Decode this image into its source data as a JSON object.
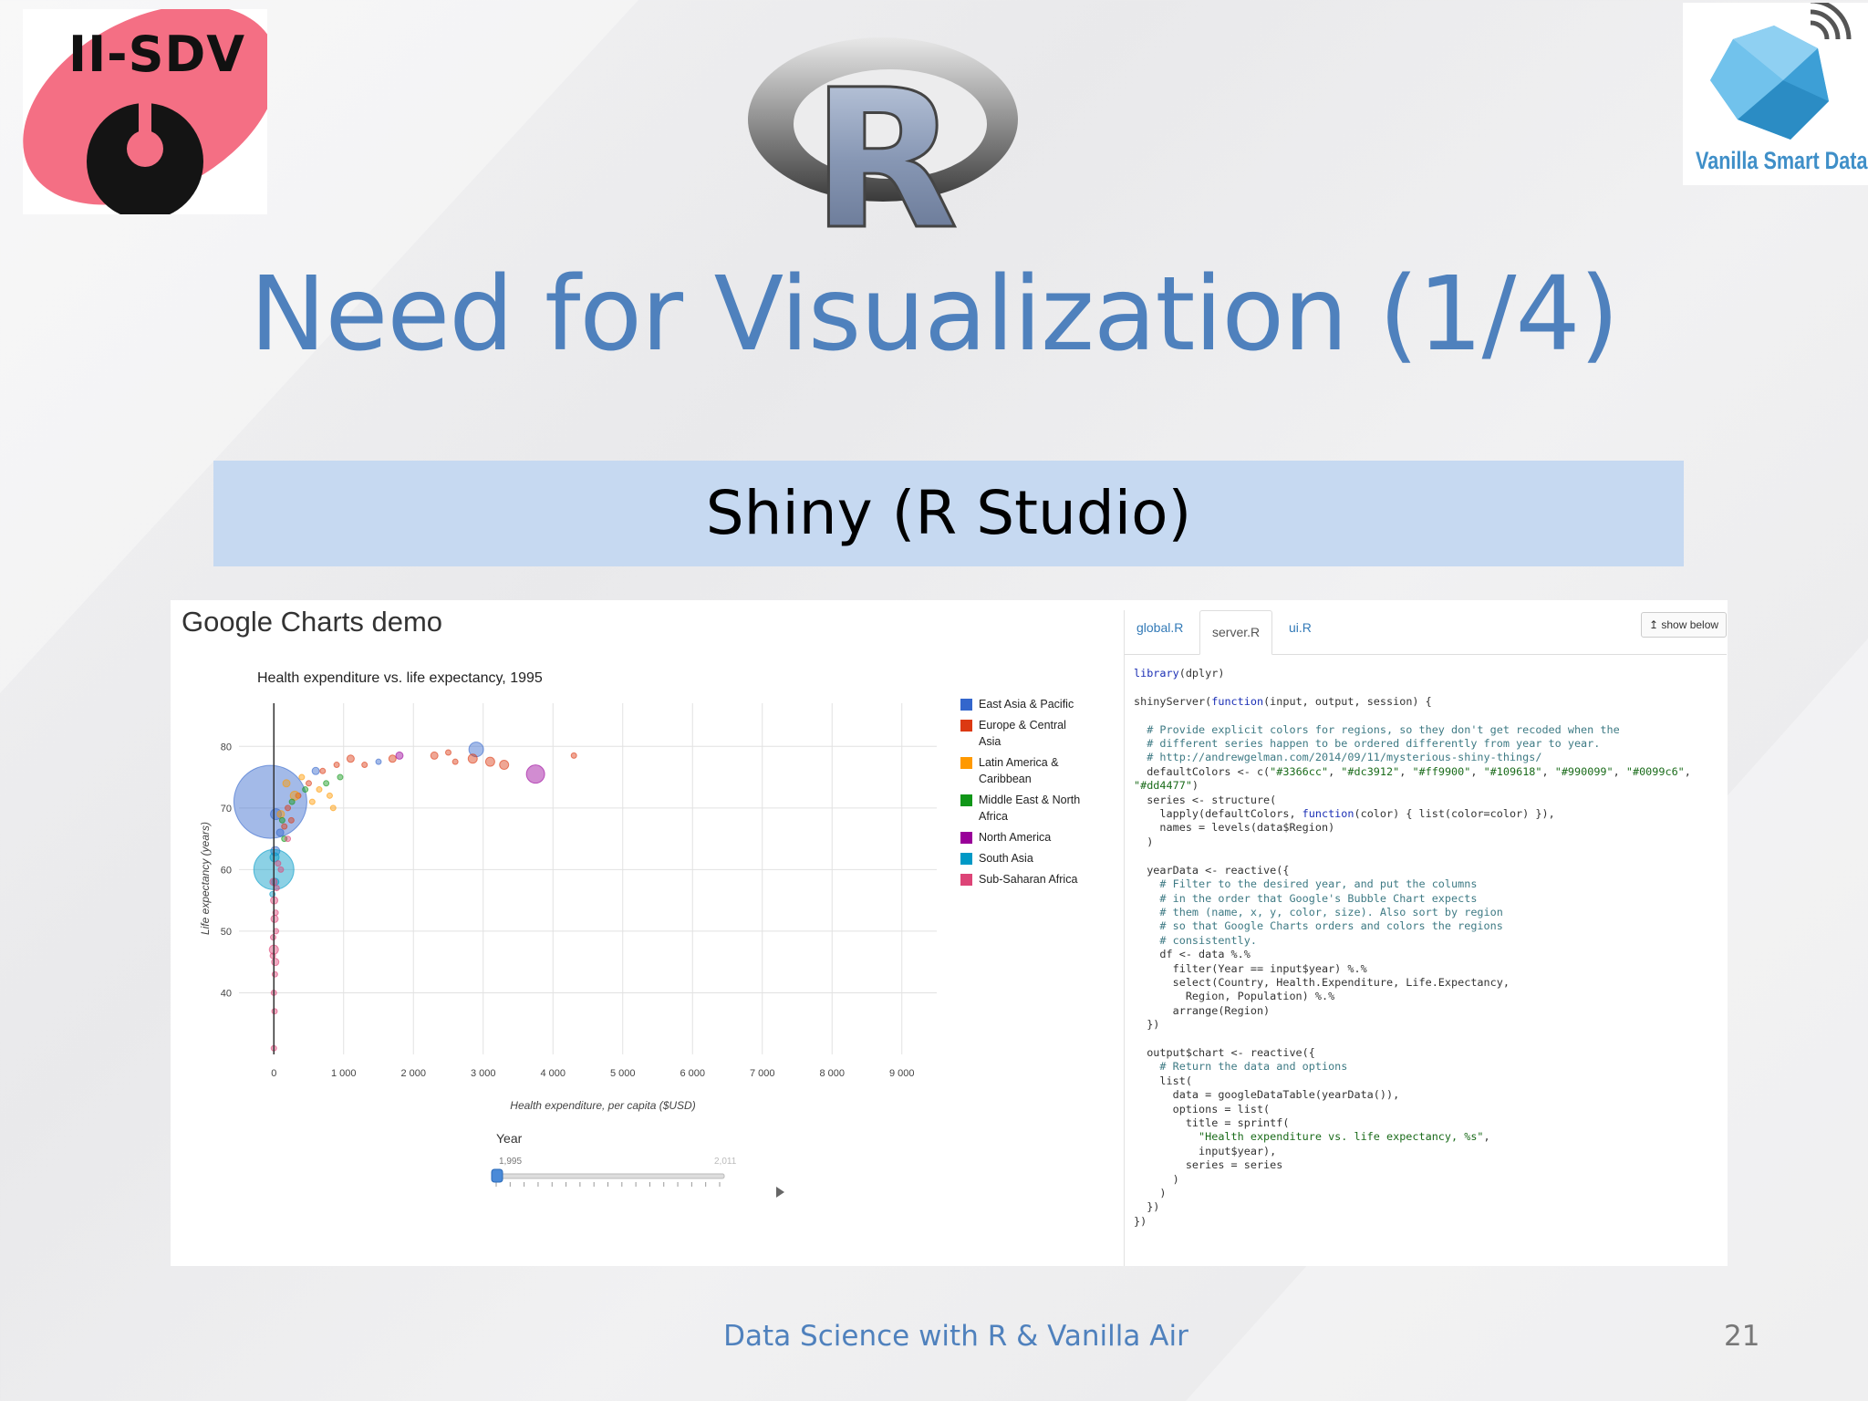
{
  "slide": {
    "title": "Need for Visualization (1/4)",
    "banner": "Shiny (R Studio)",
    "footer": "Data Science with R & Vanilla Air",
    "page_number": "21",
    "accent_color": "#4f81bd",
    "banner_color": "#c6d9f1"
  },
  "logos": {
    "left_text": "II-SDV",
    "center_letter": "R",
    "right_text": "Vanilla Smart Data"
  },
  "app": {
    "title": "Google Charts demo",
    "tabs": [
      {
        "label": "global.R",
        "active": false
      },
      {
        "label": "server.R",
        "active": true
      },
      {
        "label": "ui.R",
        "active": false
      }
    ],
    "show_below_label": "show below",
    "slider": {
      "label": "Year",
      "min_label": "1,995",
      "max_label": "2,011",
      "value": 1995,
      "min": 1995,
      "max": 2011
    }
  },
  "chart_data": {
    "type": "scatter",
    "title": "Health expenditure vs. life expectancy, 1995",
    "xlabel": "Health expenditure, per capita ($USD)",
    "ylabel": "Life expectancy (years)",
    "xlim": [
      -500,
      9500
    ],
    "ylim": [
      30,
      87
    ],
    "x_ticks": [
      0,
      1000,
      2000,
      3000,
      4000,
      5000,
      6000,
      7000,
      8000,
      9000
    ],
    "x_tick_labels": [
      "0",
      "1 000",
      "2 000",
      "3 000",
      "4 000",
      "5 000",
      "6 000",
      "7 000",
      "8 000",
      "9 000"
    ],
    "y_ticks": [
      40,
      50,
      60,
      70,
      80
    ],
    "grid": true,
    "legend_position": "right",
    "series": [
      {
        "name": "East Asia & Pacific",
        "color": "#3366cc",
        "points": [
          [
            -50,
            71,
            40
          ],
          [
            30,
            69,
            6
          ],
          [
            90,
            66,
            4
          ],
          [
            20,
            63,
            5
          ],
          [
            2900,
            79.5,
            8
          ],
          [
            600,
            76,
            4
          ],
          [
            1500,
            77.5,
            3
          ]
        ]
      },
      {
        "name": "Europe & Central Asia",
        "color": "#dc3912",
        "points": [
          [
            1100,
            78,
            4
          ],
          [
            1700,
            78,
            4
          ],
          [
            2300,
            78.5,
            4
          ],
          [
            2850,
            78,
            5
          ],
          [
            3100,
            77.5,
            5
          ],
          [
            3300,
            77,
            5
          ],
          [
            1300,
            77,
            3
          ],
          [
            2500,
            79,
            3
          ],
          [
            4300,
            78.5,
            3
          ],
          [
            200,
            70,
            3
          ],
          [
            350,
            72,
            3
          ],
          [
            500,
            74,
            3
          ],
          [
            150,
            67,
            3
          ],
          [
            250,
            68,
            3
          ],
          [
            700,
            76,
            3
          ],
          [
            900,
            77,
            3
          ],
          [
            2600,
            77.5,
            3
          ]
        ]
      },
      {
        "name": "Latin America & Caribbean",
        "color": "#ff9900",
        "points": [
          [
            300,
            72,
            5
          ],
          [
            100,
            69,
            4
          ],
          [
            180,
            74,
            4
          ],
          [
            400,
            75,
            3
          ],
          [
            800,
            72,
            3
          ],
          [
            550,
            71,
            3
          ],
          [
            650,
            73,
            3
          ],
          [
            850,
            70,
            3
          ]
        ]
      },
      {
        "name": "Middle East & North Africa",
        "color": "#109618",
        "points": [
          [
            120,
            68,
            3
          ],
          [
            260,
            71,
            3
          ],
          [
            450,
            73,
            3
          ],
          [
            750,
            74,
            3
          ],
          [
            950,
            75,
            3
          ],
          [
            150,
            65,
            3
          ]
        ]
      },
      {
        "name": "North America",
        "color": "#990099",
        "points": [
          [
            3750,
            75.5,
            10
          ],
          [
            1800,
            78.5,
            4
          ]
        ]
      },
      {
        "name": "South Asia",
        "color": "#0099c6",
        "points": [
          [
            0,
            60,
            22
          ],
          [
            10,
            62,
            5
          ],
          [
            20,
            58,
            4
          ],
          [
            -20,
            56,
            3
          ]
        ]
      },
      {
        "name": "Sub-Saharan Africa",
        "color": "#dd4477",
        "points": [
          [
            10,
            52,
            4
          ],
          [
            0,
            47,
            5
          ],
          [
            20,
            45,
            4
          ],
          [
            -10,
            49,
            3
          ],
          [
            5,
            55,
            4
          ],
          [
            15,
            43,
            3
          ],
          [
            0,
            40,
            3
          ],
          [
            25,
            53,
            3
          ],
          [
            -5,
            58,
            4
          ],
          [
            40,
            57,
            3
          ],
          [
            60,
            61,
            3
          ],
          [
            10,
            37,
            3
          ],
          [
            0,
            31,
            3
          ],
          [
            100,
            60,
            3
          ],
          [
            200,
            65,
            3
          ],
          [
            30,
            50,
            3
          ],
          [
            -15,
            46,
            3
          ]
        ]
      }
    ]
  },
  "code": [
    [
      [
        "k",
        "library"
      ],
      [
        "t",
        "(dplyr)"
      ]
    ],
    [],
    [
      [
        "t",
        "shinyServer("
      ],
      [
        "k",
        "function"
      ],
      [
        "t",
        "(input, output, session) {"
      ]
    ],
    [],
    [
      [
        "c",
        "  # Provide explicit colors for regions, so they don't get recoded when the"
      ]
    ],
    [
      [
        "c",
        "  # different series happen to be ordered differently from year to year."
      ]
    ],
    [
      [
        "c",
        "  # http://andrewgelman.com/2014/09/11/mysterious-shiny-things/"
      ]
    ],
    [
      [
        "t",
        "  defaultColors <- c("
      ],
      [
        "s",
        "\"#3366cc\""
      ],
      [
        "t",
        ", "
      ],
      [
        "s",
        "\"#dc3912\""
      ],
      [
        "t",
        ", "
      ],
      [
        "s",
        "\"#ff9900\""
      ],
      [
        "t",
        ", "
      ],
      [
        "s",
        "\"#109618\""
      ],
      [
        "t",
        ", "
      ],
      [
        "s",
        "\"#990099\""
      ],
      [
        "t",
        ", "
      ],
      [
        "s",
        "\"#0099c6\""
      ],
      [
        "t",
        ","
      ]
    ],
    [
      [
        "s",
        "\"#dd4477\""
      ],
      [
        "t",
        ")"
      ]
    ],
    [
      [
        "t",
        "  series <- structure("
      ]
    ],
    [
      [
        "t",
        "    lapply(defaultColors, "
      ],
      [
        "k",
        "function"
      ],
      [
        "t",
        "(color) { list(color=color) }),"
      ]
    ],
    [
      [
        "t",
        "    names = levels(data$Region)"
      ]
    ],
    [
      [
        "t",
        "  )"
      ]
    ],
    [],
    [
      [
        "t",
        "  yearData <- reactive({"
      ]
    ],
    [
      [
        "c",
        "    # Filter to the desired year, and put the columns"
      ]
    ],
    [
      [
        "c",
        "    # in the order that Google's Bubble Chart expects"
      ]
    ],
    [
      [
        "c",
        "    # them (name, x, y, color, size). Also sort by region"
      ]
    ],
    [
      [
        "c",
        "    # so that Google Charts orders and colors the regions"
      ]
    ],
    [
      [
        "c",
        "    # consistently."
      ]
    ],
    [
      [
        "t",
        "    df <- data %.%"
      ]
    ],
    [
      [
        "t",
        "      filter(Year == input$year) %.%"
      ]
    ],
    [
      [
        "t",
        "      select(Country, Health.Expenditure, Life.Expectancy,"
      ]
    ],
    [
      [
        "t",
        "        Region, Population) %.%"
      ]
    ],
    [
      [
        "t",
        "      arrange(Region)"
      ]
    ],
    [
      [
        "t",
        "  })"
      ]
    ],
    [],
    [
      [
        "t",
        "  output$chart <- reactive({"
      ]
    ],
    [
      [
        "c",
        "    # Return the data and options"
      ]
    ],
    [
      [
        "t",
        "    list("
      ]
    ],
    [
      [
        "t",
        "      data = googleDataTable(yearData()),"
      ]
    ],
    [
      [
        "t",
        "      options = list("
      ]
    ],
    [
      [
        "t",
        "        title = sprintf("
      ]
    ],
    [
      [
        "s",
        "          \"Health expenditure vs. life expectancy, %s\""
      ],
      [
        "t",
        ","
      ]
    ],
    [
      [
        "t",
        "          input$year),"
      ]
    ],
    [
      [
        "t",
        "        series = series"
      ]
    ],
    [
      [
        "t",
        "      )"
      ]
    ],
    [
      [
        "t",
        "    )"
      ]
    ],
    [
      [
        "t",
        "  })"
      ]
    ],
    [
      [
        "t",
        "})"
      ]
    ]
  ]
}
